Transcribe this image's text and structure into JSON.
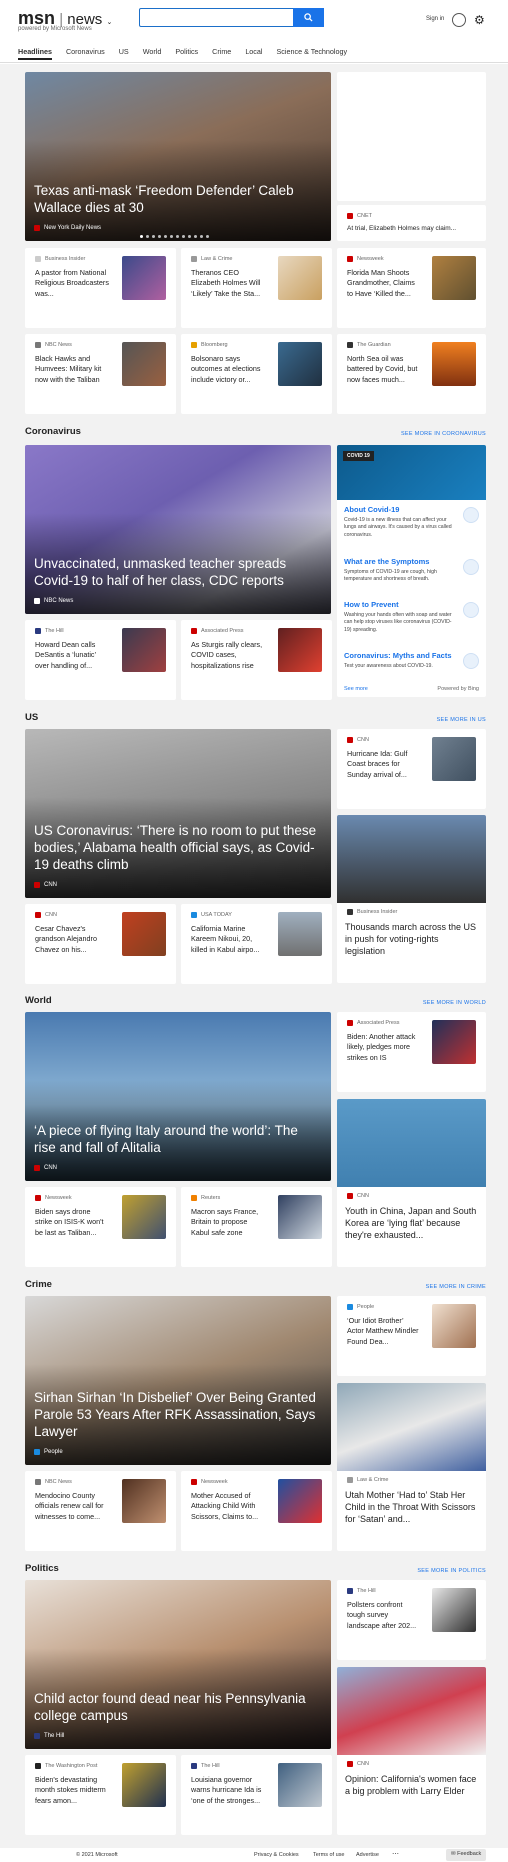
{
  "header": {
    "brand": "msn",
    "section": "news",
    "powered": "powered by Microsoft News",
    "signin": "Sign in"
  },
  "nav": [
    "Headlines",
    "Coronavirus",
    "US",
    "World",
    "Politics",
    "Crime",
    "Local",
    "Science & Technology"
  ],
  "headlines": {
    "hero": {
      "title": "Texas anti-mask ‘Freedom Defender’ Caleb Wallace dies at 30",
      "source": "New York Daily News"
    },
    "side": {
      "source": "CNET",
      "title": "At trial, Elizabeth Holmes may claim..."
    },
    "cards": [
      {
        "source": "Business Insider",
        "title": "A pastor from National Religious Broadcasters was..."
      },
      {
        "source": "Law & Crime",
        "title": "Theranos CEO Elizabeth Holmes Will ‘Likely’ Take the Sta..."
      },
      {
        "source": "Newsweek",
        "title": "Florida Man Shoots Grandmother, Claims to Have ‘Killed the..."
      },
      {
        "source": "NBC News",
        "title": "Black Hawks and Humvees: Military kit now with the Taliban"
      },
      {
        "source": "Bloomberg",
        "title": "Bolsonaro says outcomes at elections include victory or..."
      },
      {
        "source": "The Guardian",
        "title": "North Sea oil was battered by Covid, but now faces much..."
      }
    ]
  },
  "coronavirus": {
    "heading": "Coronavirus",
    "see_more": "SEE MORE IN CORONAVIRUS",
    "hero": {
      "title": "Unvaccinated, unmasked teacher spreads Covid-19 to half of her class, CDC reports",
      "source": "NBC News"
    },
    "cards": [
      {
        "source": "The Hill",
        "title": "Howard Dean calls DeSantis a ‘lunatic’ over handling of..."
      },
      {
        "source": "Associated Press",
        "title": "As Sturgis rally clears, COVID cases, hospitalizations rise"
      }
    ],
    "info": {
      "tag": "COVID 19",
      "items": [
        {
          "title": "About Covid-19",
          "desc": "Covid-19 is a new illness that can affect your lungs and airways. It's caused by a virus called coronavirus."
        },
        {
          "title": "What are the Symptoms",
          "desc": "Symptoms of COVID-19 are cough, high temperature and shortness of breath."
        },
        {
          "title": "How to Prevent",
          "desc": "Washing your hands often with soap and water can help stop viruses like coronavirus (COVID-19) spreading."
        },
        {
          "title": "Coronavirus: Myths and Facts",
          "desc": "Test your awareness about COVID-19."
        }
      ],
      "see_more": "See more",
      "powered": "Powered by Bing"
    }
  },
  "us": {
    "heading": "US",
    "see_more": "SEE MORE IN US",
    "hero": {
      "title": "US Coronavirus: ‘There is no room to put these bodies,’ Alabama health official says, as Covid-19 deaths climb",
      "source": "CNN"
    },
    "side": {
      "source": "CNN",
      "title": "Hurricane Ida: Gulf Coast braces for Sunday arrival of..."
    },
    "cards": [
      {
        "source": "CNN",
        "title": "Cesar Chavez's grandson Alejandro Chavez on his..."
      },
      {
        "source": "USA TODAY",
        "title": "California Marine Kareem Nikoui, 20, killed in Kabul airpo..."
      }
    ],
    "wide": {
      "source": "Business Insider",
      "title": "Thousands march across the US in push for voting-rights legislation"
    }
  },
  "world": {
    "heading": "World",
    "see_more": "SEE MORE IN WORLD",
    "hero": {
      "title": "‘A piece of flying Italy around the world’: The rise and fall of Alitalia",
      "source": "CNN"
    },
    "side": {
      "source": "Associated Press",
      "title": "Biden: Another attack likely, pledges more strikes on IS"
    },
    "cards": [
      {
        "source": "Newsweek",
        "title": "Biden says drone strike on ISIS-K won't be last as Taliban..."
      },
      {
        "source": "Reuters",
        "title": "Macron says France, Britain to propose Kabul safe zone"
      }
    ],
    "wide": {
      "source": "CNN",
      "title": "Youth in China, Japan and South Korea are ‘lying flat’ because they're exhausted..."
    }
  },
  "crime": {
    "heading": "Crime",
    "see_more": "SEE MORE IN CRIME",
    "hero": {
      "title": "Sirhan Sirhan ‘In Disbelief’ Over Being Granted Parole 53 Years After RFK Assassination, Says Lawyer",
      "source": "People"
    },
    "side": {
      "source": "People",
      "title": "‘Our Idiot Brother’ Actor Matthew Mindler Found Dea..."
    },
    "cards": [
      {
        "source": "NBC News",
        "title": "Mendocino County officials renew call for witnesses to come..."
      },
      {
        "source": "Newsweek",
        "title": "Mother Accused of Attacking Child With Scissors, Claims to..."
      }
    ],
    "wide": {
      "source": "Law & Crime",
      "title": "Utah Mother ‘Had to’ Stab Her Child in the Throat With Scissors for ‘Satan’ and..."
    }
  },
  "politics": {
    "heading": "Politics",
    "see_more": "SEE MORE IN POLITICS",
    "hero": {
      "title": "Child actor found dead near his Pennsylvania college campus",
      "source": "The Hill"
    },
    "side": {
      "source": "The Hill",
      "title": "Pollsters confront tough survey landscape after 202..."
    },
    "cards": [
      {
        "source": "The Washington Post",
        "title": "Biden's devastating month stokes midterm fears amon..."
      },
      {
        "source": "The Hill",
        "title": "Louisiana governor warns hurricane Ida is ‘one of the stronges..."
      }
    ],
    "wide": {
      "source": "CNN",
      "title": "Opinion: California's women face a big problem with Larry Elder"
    }
  },
  "footer": {
    "copyright": "© 2021 Microsoft",
    "links": [
      "Privacy & Cookies",
      "Terms of use",
      "Advertise"
    ],
    "feedback": "Feedback"
  }
}
